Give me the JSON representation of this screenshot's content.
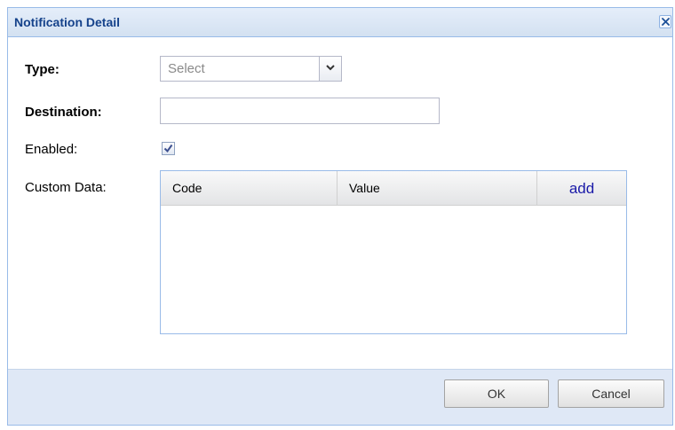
{
  "window": {
    "title": "Notification Detail"
  },
  "form": {
    "type_label": "Type:",
    "type_value": "Select",
    "destination_label": "Destination:",
    "destination_value": "",
    "enabled_label": "Enabled:",
    "enabled_checked": true,
    "custom_data_label": "Custom Data:"
  },
  "grid": {
    "columns": [
      "Code",
      "Value"
    ],
    "add_label": "add",
    "rows": []
  },
  "footer": {
    "ok_label": "OK",
    "cancel_label": "Cancel"
  },
  "icons": {
    "close": "close-icon",
    "dropdown": "chevron-down-icon",
    "check": "check-icon"
  },
  "colors": {
    "title_text": "#15428b",
    "frame": "#dfe8f6",
    "border": "#99bbe8",
    "link": "#1a1aa8"
  }
}
